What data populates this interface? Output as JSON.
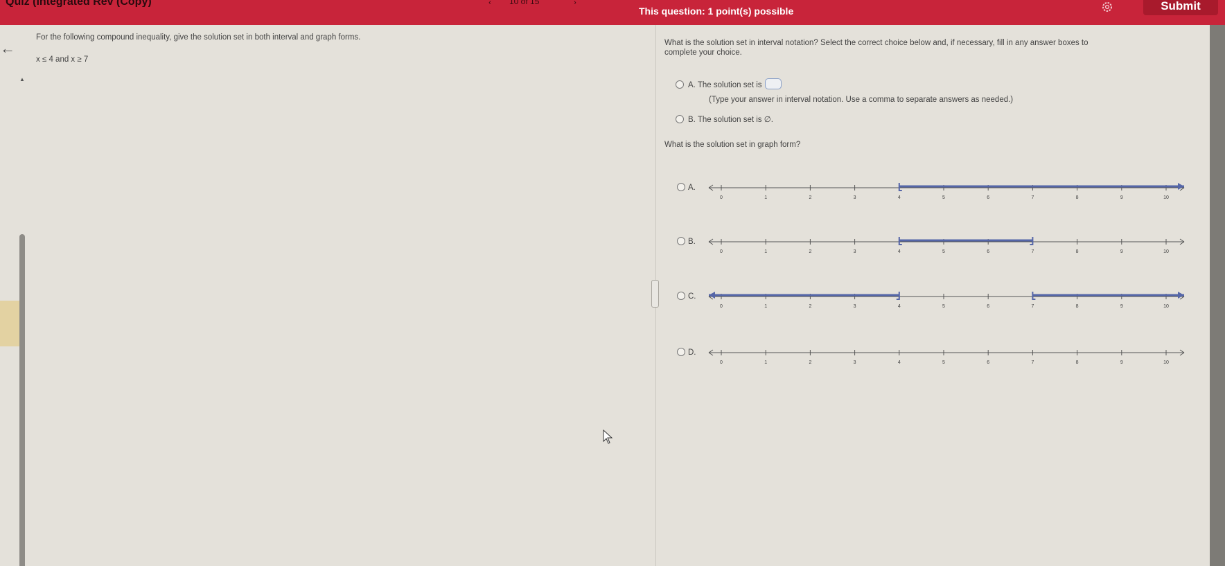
{
  "header": {
    "title": "Quiz (Integrated Rev (Copy)",
    "nav_prev": "‹",
    "nav_count": "10 of 15",
    "nav_next": "›",
    "question_points": "This question: 1 point(s) possible",
    "submit_label": "Submit",
    "colors": {
      "bar": "#c8243a",
      "submit": "#a81a2c"
    }
  },
  "left": {
    "prompt": "For the following compound inequality, give the solution set in both interval and graph forms.",
    "inequality": "x ≤ 4 and x ≥ 7"
  },
  "right": {
    "interval_question_line1": "What is the solution set in interval notation? Select the correct choice below and, if necessary, fill in any answer boxes to",
    "interval_question_line2": "complete your choice.",
    "choice_a_text": "A.  The solution set is",
    "choice_a_hint": "(Type your answer in interval notation. Use a comma to separate answers as needed.)",
    "choice_b_text": "B.  The solution set is ∅.",
    "graph_question": "What is the solution set in graph form?"
  },
  "graph_choices": [
    {
      "label": "A.",
      "segments": [
        {
          "from": 4,
          "to": "inf",
          "left_mark": "bracket",
          "right_mark": "arrow"
        }
      ]
    },
    {
      "label": "B.",
      "segments": [
        {
          "from": 4,
          "to": 7,
          "left_mark": "bracket",
          "right_mark": "bracket"
        }
      ]
    },
    {
      "label": "C.",
      "segments": [
        {
          "from": "-inf",
          "to": 4,
          "left_mark": "arrow",
          "right_mark": "bracket"
        },
        {
          "from": 7,
          "to": "inf",
          "left_mark": "bracket",
          "right_mark": "arrow"
        }
      ]
    },
    {
      "label": "D.",
      "segments": []
    }
  ],
  "number_line": {
    "min": 0,
    "max": 10,
    "ticks": [
      "0",
      "1",
      "2",
      "3",
      "4",
      "5",
      "6",
      "7",
      "8",
      "9",
      "10"
    ],
    "highlight_color": "#5566a8"
  }
}
